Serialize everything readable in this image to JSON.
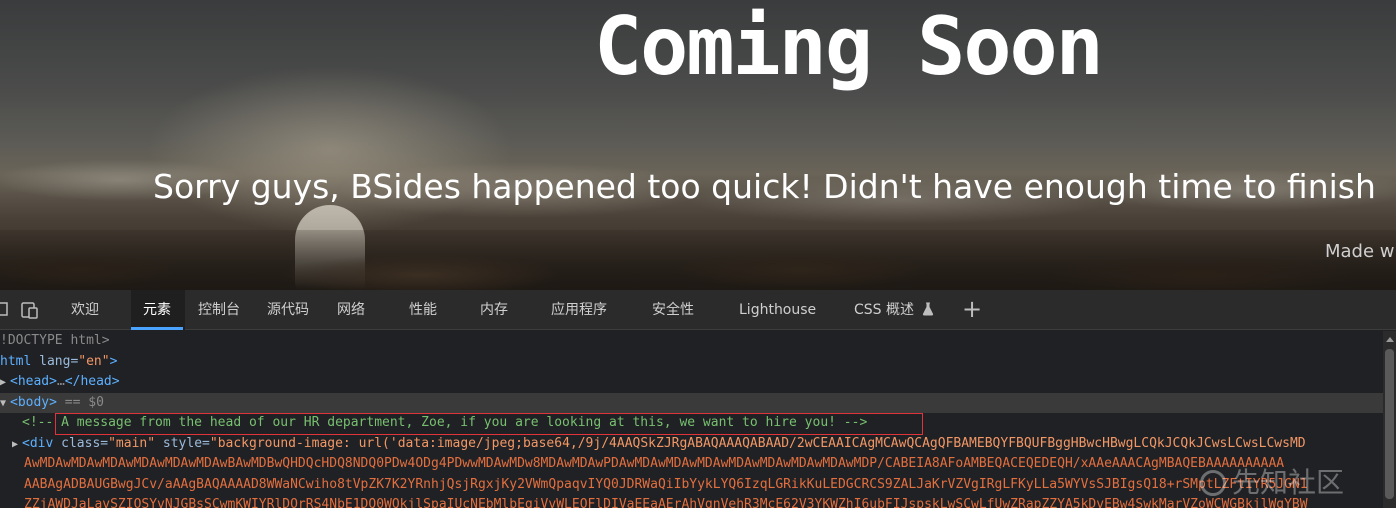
{
  "page": {
    "heading": "Coming Soon",
    "subheading": "Sorry guys, BSides happened too quick! Didn't have enough time to finish",
    "made_with": "Made w"
  },
  "devtools": {
    "tabs": [
      {
        "label": "欢迎"
      },
      {
        "label": "元素"
      },
      {
        "label": "控制台"
      },
      {
        "label": "源代码"
      },
      {
        "label": "网络"
      },
      {
        "label": "性能"
      },
      {
        "label": "内存"
      },
      {
        "label": "应用程序"
      },
      {
        "label": "安全性"
      },
      {
        "label": "Lighthouse"
      },
      {
        "label": "CSS 概述"
      }
    ],
    "active_tab": "元素",
    "add_tab": "+",
    "dom": {
      "doctype": "!DOCTYPE html>",
      "html_open": "html",
      "lang_attr": "lang",
      "lang_value": "\"en\"",
      "head_tag": "<head>",
      "head_ellipsis": "…",
      "head_close": "</head>",
      "body_tag": "<body>",
      "body_eq": "== $0",
      "comment": "<!-- A message from the head of our HR department, Zoe, if you are looking at this, we want to hire you! -->",
      "div_open": "<div",
      "class_attr": "class",
      "class_value": "\"main\"",
      "style_attr": "style",
      "style_prefix": "\"background-image: url('data:image/jpeg;base64,/9j/4AAQSkZJRgABAQAAAQABAAD/2wCEAAICAgMCAwQCAgQFBAMEBQYFBQUFBggHBwcHBwgLCQkJCQkJCwsLCwsLCwsMD",
      "data_line_2": "AwMDAwMDAwMDAwMDAwMDAwMDAwBAwMDBwQHDQcHDQ8NDQ0PDw4ODg4PDwwMDAwMDw8MDAwMDAwPDAwMDAwMDAwMDAwMDAwMDAwMDAwMDAwMDP/CABEIA8AFoAMBEQACEQEDEQH/xAAeAAACAgMBAQEBAAAAAAAAAA",
      "data_line_3": "AABAgADBAUGBwgJCv/aAAgBAQAAAAD8WWaNCwiho8tVpZK7K2YRnhjQsjRgxjKy2VWmQpaqvIYQ0JDRWaQiIbYykLYQ6IzqLGRikKuLEDGCRCS9ZALJaKrVZVgIRgLFKyLLa5WYVsSJBIgsQ18+rSMptLZFtIYR5JGN1",
      "data_line_4": "ZZjAWDJaLavSZIOSYvNJGBsSCwmKWIYRlDOrRS4NbE1DQ0WQkjlSpaIUcNEbMlbEqiVvWLEOFlDIVaEEaAErAhVqnVehR3McE62V3YKWZhI6ubFIJspskLwSCwLfUwZRapZZYA5kDvEBw4SwkMarVZoWCWGBkjlWgYBW"
    }
  },
  "watermark": "先知社区"
}
